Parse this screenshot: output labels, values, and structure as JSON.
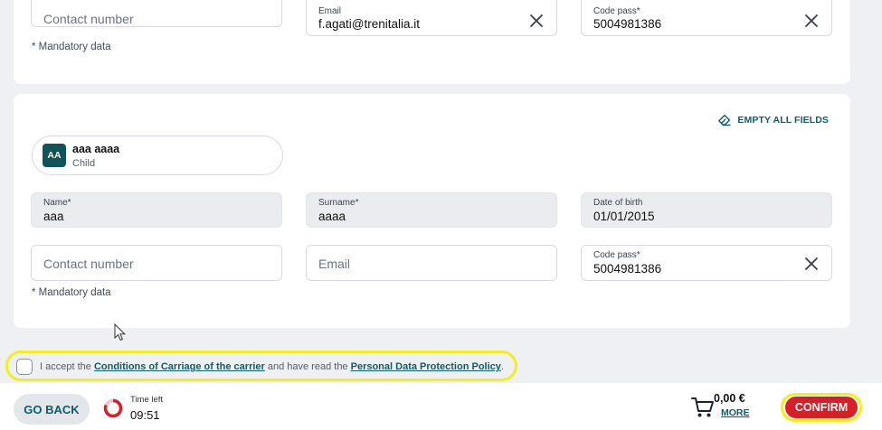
{
  "passenger1": {
    "contact": {
      "placeholder": "Contact number"
    },
    "email": {
      "label": "Email",
      "value": "f.agati@trenitalia.it"
    },
    "code_pass": {
      "label": "Code pass*",
      "value": "5004981386"
    },
    "mandatory": "* Mandatory data"
  },
  "passenger2": {
    "empty_all": "EMPTY ALL FIELDS",
    "initials": "AA",
    "name_full": "aaa aaaa",
    "type": "Child",
    "name": {
      "label": "Name*",
      "value": "aaa"
    },
    "surname": {
      "label": "Surname*",
      "value": "aaaa"
    },
    "dob": {
      "label": "Date of birth",
      "value": "01/01/2015"
    },
    "contact": {
      "placeholder": "Contact number"
    },
    "email": {
      "placeholder": "Email"
    },
    "code_pass": {
      "label": "Code pass*",
      "value": "5004981386"
    },
    "mandatory": "* Mandatory data"
  },
  "consent": {
    "prefix": "I accept the ",
    "link1": "Conditions of Carriage of the carrier",
    "middle": " and have read the ",
    "link2": "Personal Data Protection Policy",
    "suffix": "."
  },
  "footer": {
    "go_back": "GO BACK",
    "time_left_label": "Time left",
    "time_left": "09:51",
    "price": "0,00 €",
    "more": "MORE",
    "confirm": "CONFIRM"
  },
  "colors": {
    "accent": "#0e5d67",
    "confirm": "#d81e26",
    "highlight": "#f2ef1d",
    "avatar": "#0f5458"
  }
}
